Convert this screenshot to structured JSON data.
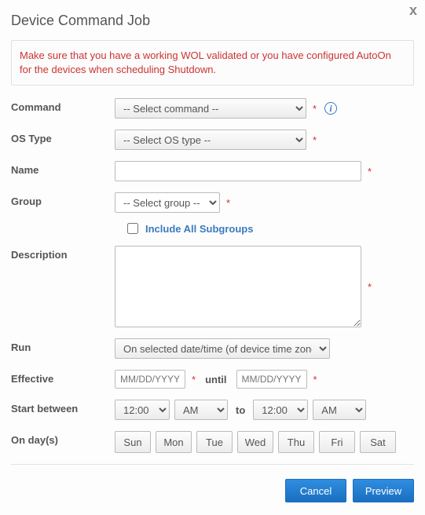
{
  "title": "Device Command Job",
  "warning": "Make sure that you have a working WOL validated or you have configured AutoOn for the devices when scheduling Shutdown.",
  "labels": {
    "command": "Command",
    "osType": "OS Type",
    "name": "Name",
    "group": "Group",
    "includeSubgroups": "Include All Subgroups",
    "description": "Description",
    "run": "Run",
    "effective": "Effective",
    "until": "until",
    "startBetween": "Start between",
    "to": "to",
    "onDays": "On day(s)"
  },
  "placeholders": {
    "command": "-- Select command --",
    "osType": "-- Select OS type --",
    "group": "-- Select group --",
    "date": "MM/DD/YYYY"
  },
  "values": {
    "name": "",
    "includeSubgroups": false,
    "description": "",
    "run": "On selected date/time (of device time zone)",
    "effectiveFrom": "",
    "effectiveUntil": "",
    "startHour1": "12:00",
    "startAmPm1": "AM",
    "startHour2": "12:00",
    "startAmPm2": "AM"
  },
  "days": [
    "Sun",
    "Mon",
    "Tue",
    "Wed",
    "Thu",
    "Fri",
    "Sat"
  ],
  "footer": {
    "cancel": "Cancel",
    "preview": "Preview"
  },
  "required_marker": "*"
}
